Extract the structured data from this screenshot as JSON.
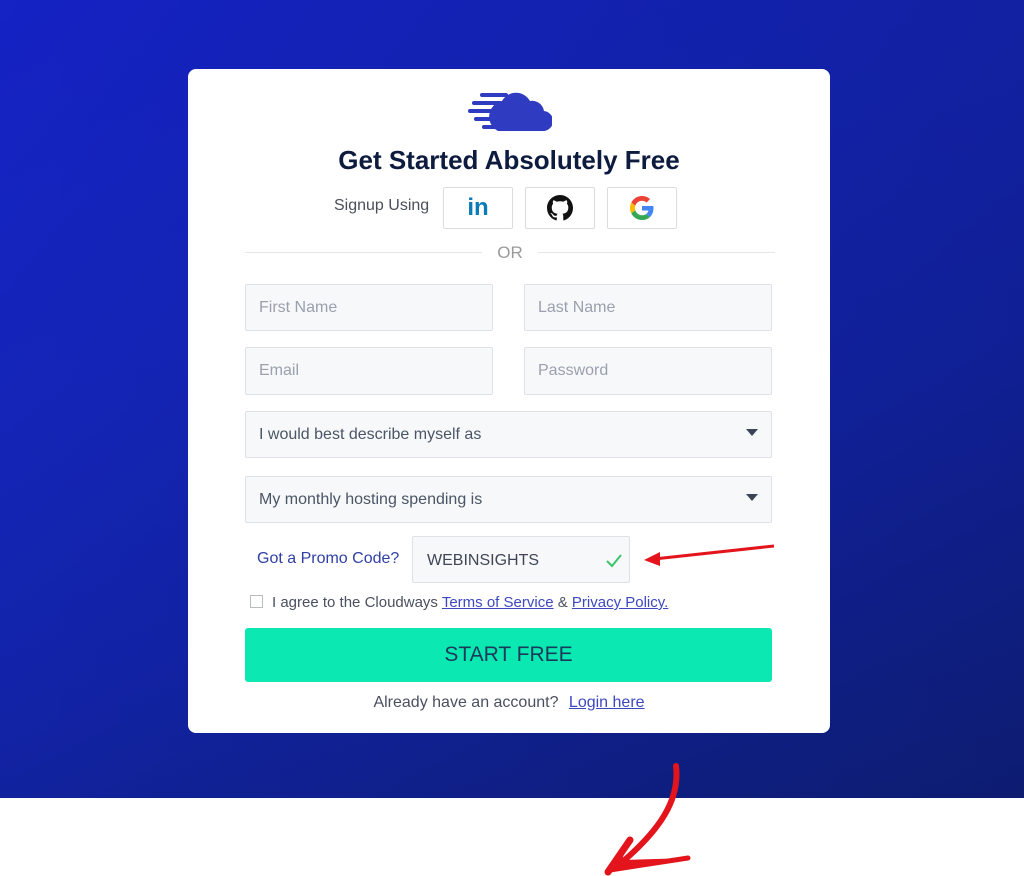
{
  "card": {
    "title": "Get Started Absolutely Free",
    "signup_label": "Signup Using",
    "social": [
      {
        "name": "linkedin",
        "label": "in",
        "color": "#0a7bb7"
      },
      {
        "name": "github",
        "color": "#111111"
      },
      {
        "name": "google"
      }
    ],
    "or_text": "OR"
  },
  "form": {
    "first_name": {
      "placeholder": "First Name",
      "value": ""
    },
    "last_name": {
      "placeholder": "Last Name",
      "value": ""
    },
    "email": {
      "placeholder": "Email",
      "value": ""
    },
    "password": {
      "placeholder": "Password",
      "value": ""
    },
    "describe_select": {
      "selected": "I would best describe myself as"
    },
    "spending_select": {
      "selected": "My monthly hosting spending is"
    },
    "promo": {
      "label": "Got a Promo Code?",
      "value": "WEBINSIGHTS",
      "status": "valid"
    },
    "agree": {
      "checked": false,
      "text": "I agree to the Cloudways",
      "terms_link": "Terms of Service",
      "ampersand": "&",
      "privacy_link": "Privacy Policy."
    },
    "submit_label": "START FREE",
    "login_prompt": "Already have an account?",
    "login_link": "Login here"
  },
  "colors": {
    "brand_blue": "#2f3bc0",
    "cta_green": "#0ce8b2",
    "annotation_red": "#e3141b",
    "title_navy": "#0d1b3e"
  }
}
